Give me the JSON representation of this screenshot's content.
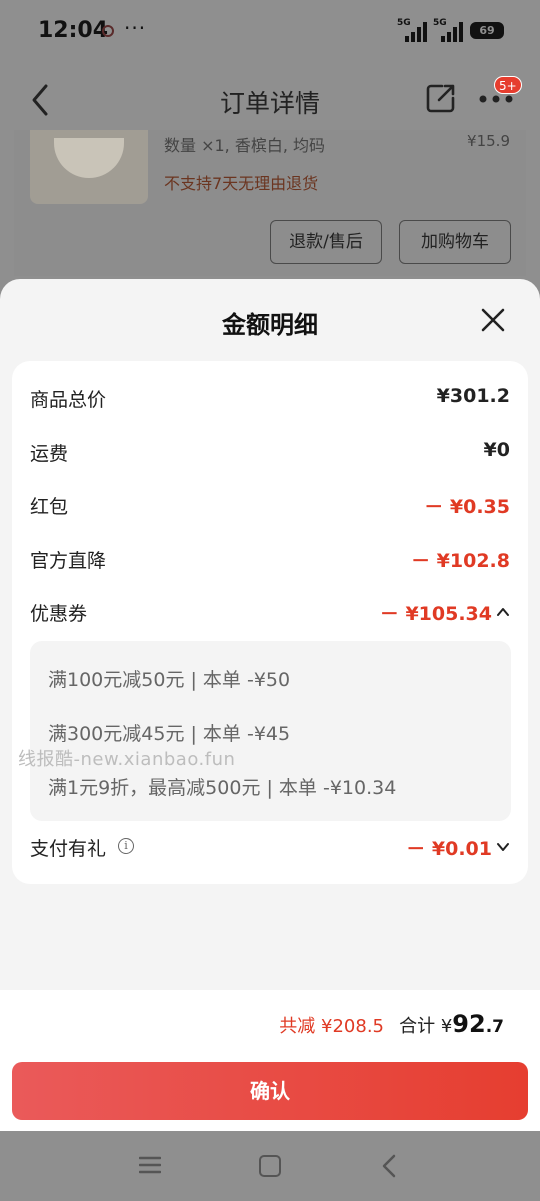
{
  "status_bar": {
    "time": "12:04",
    "more": "···",
    "sig1": "5G",
    "sig2": "5G",
    "battery": "69"
  },
  "header": {
    "title": "订单详情",
    "badge": "5+"
  },
  "product": {
    "spec": "数量 ×1, 香槟白, 均码",
    "price": "¥15.9",
    "notice": "不支持7天无理由退货",
    "refund_btn": "退款/售后",
    "cart_btn": "加购物车"
  },
  "sheet": {
    "title": "金额明细",
    "rows": [
      {
        "label": "商品总价",
        "value": "¥301.2"
      },
      {
        "label": "运费",
        "value": "¥0"
      },
      {
        "label": "红包",
        "value": "－ ¥0.35"
      },
      {
        "label": "官方直降",
        "value": "－ ¥102.8"
      },
      {
        "label": "优惠券",
        "value": "－ ¥105.34"
      },
      {
        "label": "支付有礼",
        "value": "－ ¥0.01"
      }
    ],
    "coupons": [
      "满100元减50元 | 本单 -¥50",
      "满300元减45元 | 本单 -¥45",
      "满1元9折，最高减500元 | 本单 -¥10.34"
    ],
    "info_glyph": "i",
    "watermark": "线报酷-new.xianbao.fun"
  },
  "footer": {
    "total_reduce": "共减 ¥208.5",
    "total_label": "合计 ¥",
    "total_int": "92",
    "total_dec": ".7",
    "confirm": "确认"
  },
  "colors": {
    "accent_red": "#e03a24",
    "button_start": "#ea5a5a",
    "button_end": "#e63e30"
  }
}
